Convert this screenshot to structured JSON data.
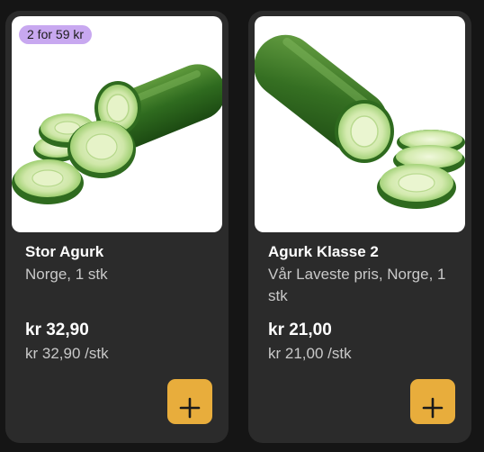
{
  "products": [
    {
      "badge": "2 for 59 kr",
      "title": "Stor Agurk",
      "desc": "Norge, 1 stk",
      "price": "kr 32,90",
      "unit_price": "kr 32,90 /stk",
      "image_icon": "cucumber-sliced-image",
      "add_icon": "plus-icon"
    },
    {
      "title": "Agurk Klasse 2",
      "desc": "Vår Laveste pris, Norge, 1 stk",
      "price": "kr 21,00",
      "unit_price": "kr 21,00 /stk",
      "image_icon": "cucumber-cut-image",
      "add_icon": "plus-icon"
    }
  ],
  "colors": {
    "page_bg": "#151515",
    "card_bg": "#2b2b2b",
    "badge_bg": "#c8a8f0",
    "add_button": "#e8ad3c"
  }
}
